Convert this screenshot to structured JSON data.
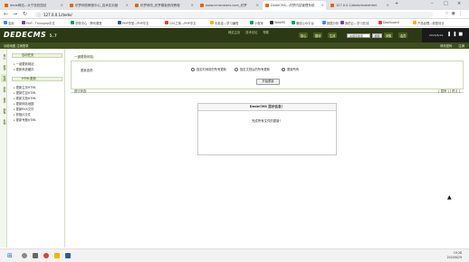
{
  "browser": {
    "tabs": [
      {
        "label": "dede网站—大宁校校园站",
        "active": false
      },
      {
        "label": "织梦网校教程中心_技术实训营",
        "active": false
      },
      {
        "label": "织梦修改_织梦模板修改教程",
        "active": false
      },
      {
        "label": "www.cmsinsters.com_织梦",
        "active": false
      },
      {
        "label": "DedeCMS—织梦内容管理系统",
        "active": true
      },
      {
        "label": "127.0.0.1/dede/makehtml",
        "active": false
      }
    ],
    "url": "127.0.0.1/dede/",
    "bookmarks": [
      {
        "label": "应用",
        "color": "#4285f4"
      },
      {
        "label": "PHP - Thinkphp中文",
        "color": "#7b3fa0"
      },
      {
        "label": "学院中心 · 腾讯课堂",
        "color": "#0f9d58"
      },
      {
        "label": "PHP学堂—PHP中文",
        "color": "#2c5aa0"
      },
      {
        "label": "CSS之家—PHP中文",
        "color": "#db4437"
      },
      {
        "label": "兄弟连—学习编程",
        "color": "#f4b400"
      },
      {
        "label": "小程序",
        "color": "#0f9d58"
      },
      {
        "label": "WebMS",
        "color": "#333333"
      },
      {
        "label": "微信公众平台",
        "color": "#0f9d58"
      },
      {
        "label": "数据分析",
        "color": "#4285f4"
      },
      {
        "label": "我的云—学习在线",
        "color": "#7b3fa0"
      },
      {
        "label": "Dashboard",
        "color": "#db4437"
      },
      {
        "label": "产品经理—原型设计",
        "color": "#f4b400"
      }
    ]
  },
  "cms": {
    "logo": "DEDECMS",
    "version": "5.7",
    "top_links": [
      "网站主页",
      "技术论坛",
      "帮助",
      "核心",
      "模块",
      "生成",
      "采集",
      "会员",
      "模板",
      "系统",
      "织梦服务"
    ],
    "search_value": "关键字搜索",
    "search_button": "搜索",
    "date": "2020/6/29",
    "subbar_left": "功能地图  注销登录",
    "subbar_right": [
      "修改密码",
      "注销"
    ],
    "vertical_tabs": [
      "核心",
      "模块",
      "生成",
      "采集",
      "会员",
      "模板",
      "系统"
    ],
    "sidebar": {
      "group1": "自动任务",
      "group1_items": [
        "一键更新网站",
        "更新系统缓存"
      ],
      "group2": "HTML更新",
      "group2_items": [
        "更新主页HTML",
        "更新栏目HTML",
        "更新文档HTML",
        "更新网站地图",
        "更新RSS文件",
        "获取JS文件",
        "更新专题HTML"
      ]
    },
    "main": {
      "section_title": "一键更新网站：",
      "option_label": "更新选项：",
      "options": [
        "指定时间前的所有更新",
        "指定文档后的所有更新",
        "更新所有"
      ],
      "selected_option": 2,
      "start_button": "开始更新",
      "progress_left": "进行状态：",
      "progress_right": "[ 暂停 ]  [ 终止 ]",
      "dialog_title": "DedeCMS 提示信息！",
      "dialog_message": "完成所有文件的更新！"
    }
  },
  "taskbar": {
    "time": "19:28",
    "date": "2020/6/29"
  }
}
